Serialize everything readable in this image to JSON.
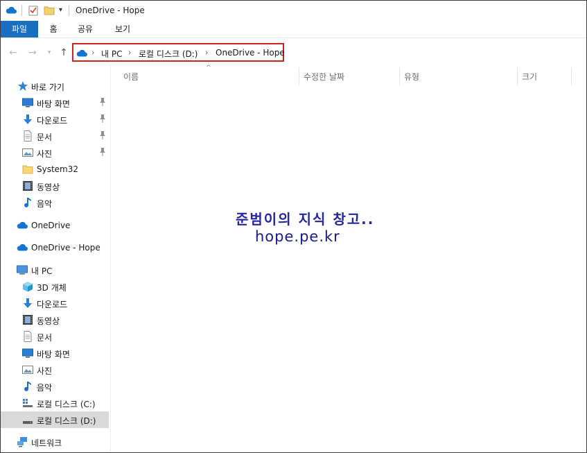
{
  "window": {
    "title": "OneDrive - Hope"
  },
  "ribbon": {
    "tabs": [
      "파일",
      "홈",
      "공유",
      "보기"
    ]
  },
  "address": {
    "parts": [
      "내 PC",
      "로컬 디스크 (D:)",
      "OneDrive - Hope"
    ]
  },
  "columns": [
    "이름",
    "수정한 날짜",
    "유형",
    "크기"
  ],
  "sidebar": {
    "quick_access": "바로 가기",
    "quick_items": [
      "바탕 화면",
      "다운로드",
      "문서",
      "사진",
      "System32",
      "동영상",
      "음악"
    ],
    "onedrive": "OneDrive",
    "onedrive_hope": "OneDrive - Hope",
    "this_pc": "내 PC",
    "pc_items": [
      "3D 개체",
      "다운로드",
      "동영상",
      "문서",
      "바탕 화면",
      "사진",
      "음악",
      "로컬 디스크 (C:)",
      "로컬 디스크 (D:)"
    ],
    "network": "네트워크"
  },
  "watermark": {
    "line1": "준범이의 지식 창고..",
    "line2": "hope.pe.kr"
  },
  "colors": {
    "accent": "#1a6fc0",
    "highlight_border": "#d02020",
    "selected_bg": "#d9d9d9"
  }
}
